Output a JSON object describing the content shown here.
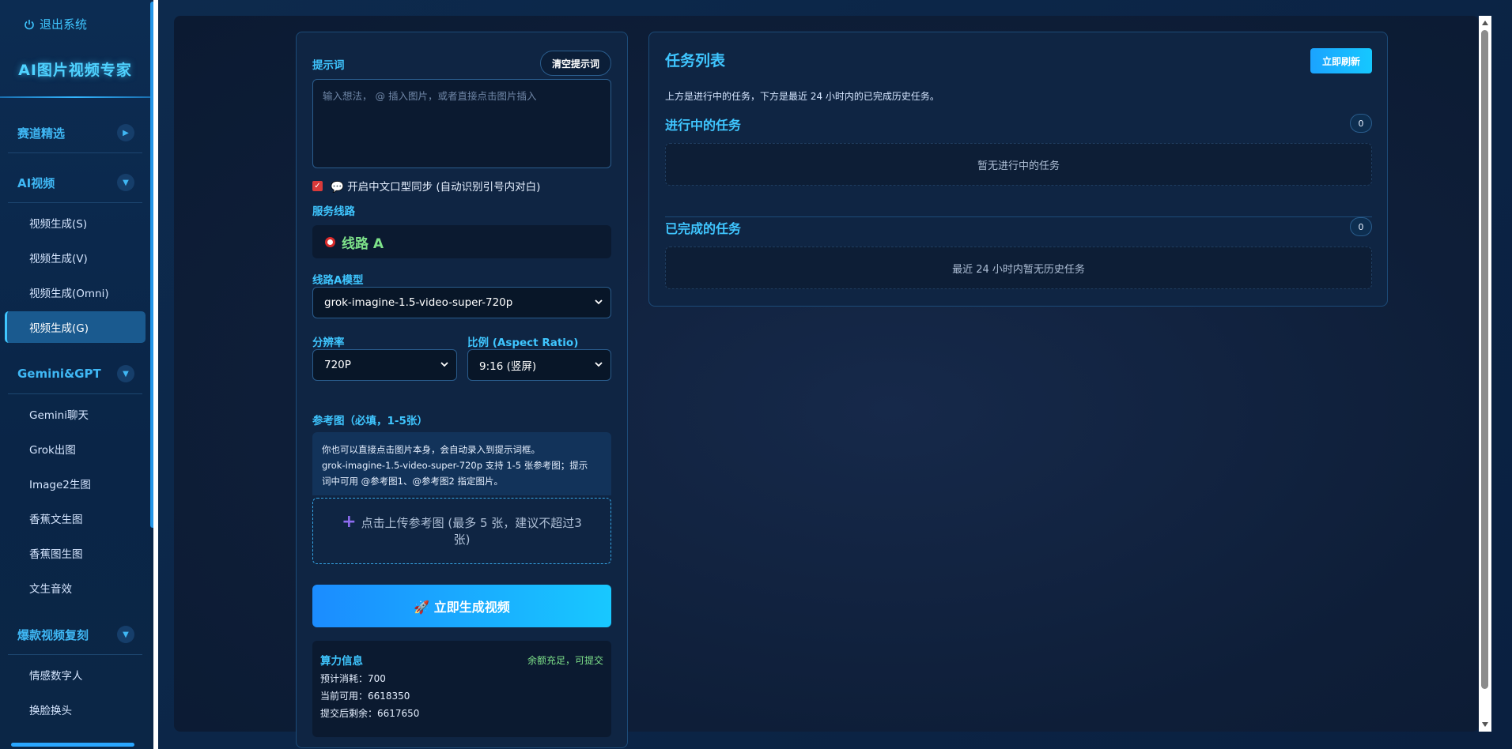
{
  "sidebar": {
    "logout_label": "退出系统",
    "brand": "AI图片视频专家",
    "sections": [
      {
        "label": "赛道精选",
        "toggle": "▶"
      },
      {
        "label": "AI视频",
        "toggle": "▼"
      },
      {
        "label": "Gemini&GPT",
        "toggle": "▼"
      },
      {
        "label": "爆款视频复刻",
        "toggle": "▼"
      }
    ],
    "items": [
      {
        "label": "视频生成(S)"
      },
      {
        "label": "视频生成(V)"
      },
      {
        "label": "视频生成(Omni)"
      },
      {
        "label": "视频生成(G)"
      },
      {
        "label": "Gemini聊天"
      },
      {
        "label": "Grok出图"
      },
      {
        "label": "Image2生图"
      },
      {
        "label": "香蕉文生图"
      },
      {
        "label": "香蕉图生图"
      },
      {
        "label": "文生音效"
      },
      {
        "label": "情感数字人"
      },
      {
        "label": "换脸换头"
      }
    ],
    "active_item": "视频生成(G)"
  },
  "form": {
    "prompt_label": "提示词",
    "clear_button": "清空提示词",
    "prompt_placeholder": "输入想法， @ 插入图片，或者直接点击图片插入",
    "lip_sync_checked": true,
    "lip_sync_label": "💬 开启中文口型同步 (自动识别引号内对白)",
    "route_label": "服务线路",
    "route_value": "线路 A",
    "model_label": "线路A模型",
    "model_value": "grok-imagine-1.5-video-super-720p",
    "resolution_label": "分辨率",
    "resolution_value": "720P",
    "ratio_label": "比例 (Aspect Ratio)",
    "ratio_value": "9:16 (竖屏)",
    "ref_label": "参考图（必填，1-5张）",
    "ref_info_lines": [
      "你也可以直接点击图片本身，会自动录入到提示词框。",
      "grok-imagine-1.5-video-super-720p 支持 1-5 张参考图；提示",
      "词中可用 @参考图1、@参考图2 指定图片。"
    ],
    "upload_text": "点击上传参考图 (最多 5 张，建议不超过3张)",
    "generate_button": "🚀 立即生成视频"
  },
  "power": {
    "title": "算力信息",
    "status": "余额充足，可提交",
    "estimate": "预计消耗：700",
    "available": "当前可用：6618350",
    "after": "提交后剩余：6617650"
  },
  "tasks": {
    "title": "任务列表",
    "refresh_button": "立即刷新",
    "description": "上方是进行中的任务，下方是最近 24 小时内的已完成历史任务。",
    "running_title": "进行中的任务",
    "running_count": "0",
    "running_empty": "暂无进行中的任务",
    "done_title": "已完成的任务",
    "done_count": "0",
    "done_empty": "最近 24 小时内暂无历史任务"
  },
  "icons": {
    "logout": "power-icon",
    "route": "radio-dot-icon",
    "select_chevron": "chevron-down-icon",
    "upload": "plus-icon",
    "generate": "rocket-icon",
    "chat": "speech-bubble-icon"
  },
  "colors": {
    "accent": "#3fc6ff",
    "success": "#7ee28a",
    "button_gradient_start": "#1b8cff",
    "button_gradient_end": "#18c8ff",
    "background": "#0a1a33"
  }
}
